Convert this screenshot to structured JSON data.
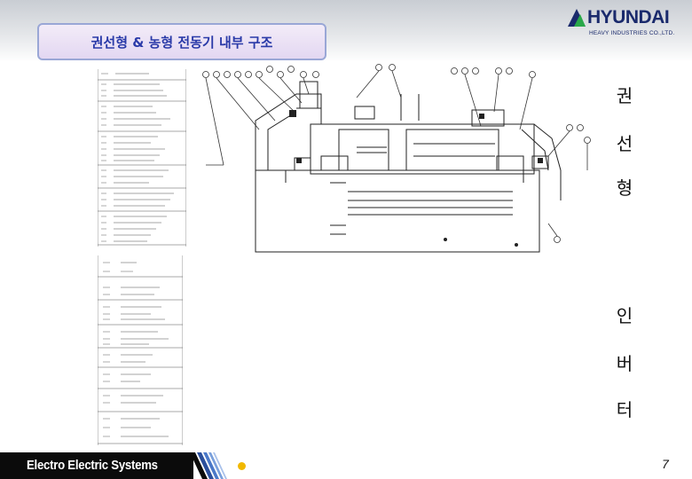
{
  "slide": {
    "title": "권선형 & 농형 전동기 내부 구조",
    "page_number": "7"
  },
  "logo": {
    "name": "HYUNDAI",
    "subtitle": "HEAVY INDUSTRIES CO.,LTD."
  },
  "side_labels": {
    "group1": [
      "권",
      "선",
      "형"
    ],
    "group2": [
      "인",
      "버",
      "터"
    ]
  },
  "footer": {
    "text": "Electro Electric Systems"
  },
  "colors": {
    "title_text": "#2a3aa8",
    "title_border": "#9aa7d6",
    "logo": "#1a2a6c",
    "footer_bg": "#0b0b0b",
    "footer_accent": "#f1b800"
  }
}
